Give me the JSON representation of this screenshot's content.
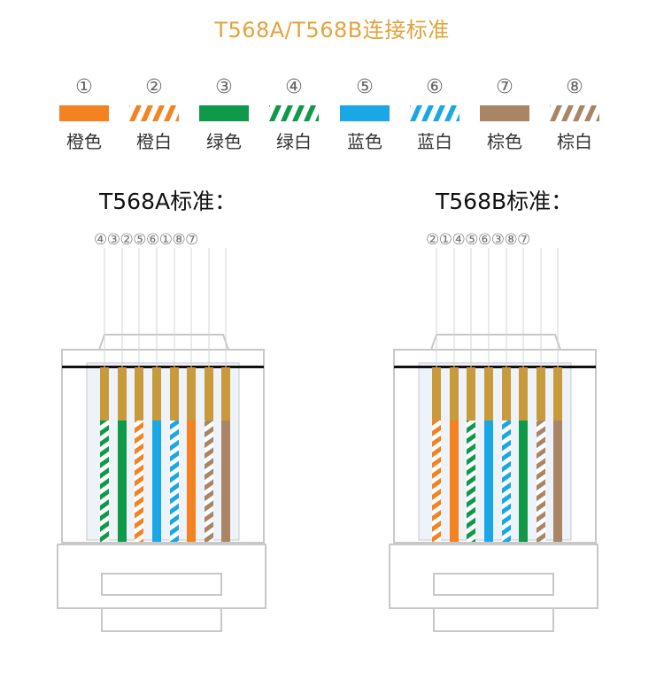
{
  "title": "T568A/T568B连接标准",
  "legend": [
    {
      "num": "①",
      "label": "橙色",
      "color": "#f58220",
      "striped": false
    },
    {
      "num": "②",
      "label": "橙白",
      "color": "#f58220",
      "striped": true
    },
    {
      "num": "③",
      "label": "绿色",
      "color": "#0f9a49",
      "striped": false
    },
    {
      "num": "④",
      "label": "绿白",
      "color": "#0f9a49",
      "striped": true
    },
    {
      "num": "⑤",
      "label": "蓝色",
      "color": "#1aa7e6",
      "striped": false
    },
    {
      "num": "⑥",
      "label": "蓝白",
      "color": "#1aa7e6",
      "striped": true
    },
    {
      "num": "⑦",
      "label": "棕色",
      "color": "#a98566",
      "striped": false
    },
    {
      "num": "⑧",
      "label": "棕白",
      "color": "#a98566",
      "striped": true
    }
  ],
  "standards": [
    {
      "title": "T568A标准：",
      "pin_labels": "④③②⑤⑥①⑧⑦",
      "order": [
        4,
        3,
        2,
        5,
        6,
        1,
        8,
        7
      ]
    },
    {
      "title": "T568B标准：",
      "pin_labels": "②①④⑤⑥③⑧⑦",
      "order": [
        2,
        1,
        4,
        5,
        6,
        3,
        8,
        7
      ]
    }
  ],
  "colors": {
    "gold": "#c89a3c",
    "outline": "#c8c8c8",
    "bar": "#111111"
  }
}
